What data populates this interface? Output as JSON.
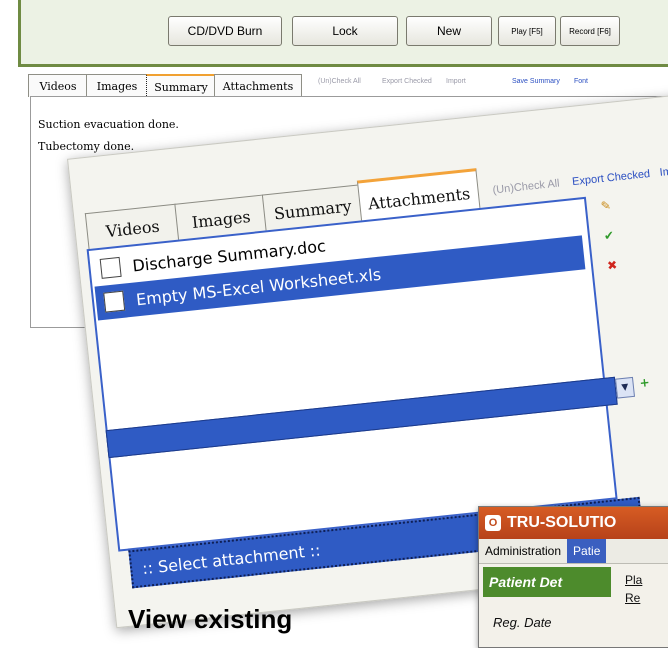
{
  "toolbar": {
    "burn_label": "CD/DVD Burn",
    "lock_label": "Lock",
    "new_label": "New",
    "play_label": "Play [F5]",
    "record_label": "Record [F6]"
  },
  "back_panel": {
    "tabs": [
      {
        "label": "Videos"
      },
      {
        "label": "Images"
      },
      {
        "label": "Summary",
        "active": true
      },
      {
        "label": "Attachments"
      }
    ],
    "actions": [
      "(Un)Check All",
      "Export Checked",
      "Import",
      "Save Summary",
      "Font"
    ],
    "summary_lines": [
      "Suction evacuation done.",
      "Tubectomy done."
    ]
  },
  "front_panel": {
    "tabs": [
      {
        "label": "Videos"
      },
      {
        "label": "Images"
      },
      {
        "label": "Summary"
      },
      {
        "label": "Attachments",
        "active": true
      }
    ],
    "actions": [
      "(Un)Check All",
      "Export Checked",
      "Import"
    ],
    "attachments": [
      {
        "name": "Discharge Summary.doc",
        "selected": false,
        "checked": false
      },
      {
        "name": "Empty MS-Excel Worksheet.xls",
        "selected": true,
        "checked": false
      }
    ],
    "select_placeholder": ":: Select attachment ::"
  },
  "tru_window": {
    "title": "TRU-SOLUTIO",
    "menu": [
      "Administration",
      "Patie"
    ],
    "side_header": "Patient Det",
    "links": [
      "Pla",
      "Re"
    ],
    "reg_date_label": "Reg. Date"
  },
  "caption": "View existing",
  "colors": {
    "selection_blue": "#2f5bc4",
    "active_tab_accent": "#f3a33a",
    "toolbar_border": "#6f8b43",
    "tru_title": "#c84f1f",
    "tru_side": "#4d8b2c"
  },
  "icons": [
    "edit-icon",
    "check-icon",
    "delete-icon",
    "add-icon",
    "dropdown-arrow-icon"
  ]
}
